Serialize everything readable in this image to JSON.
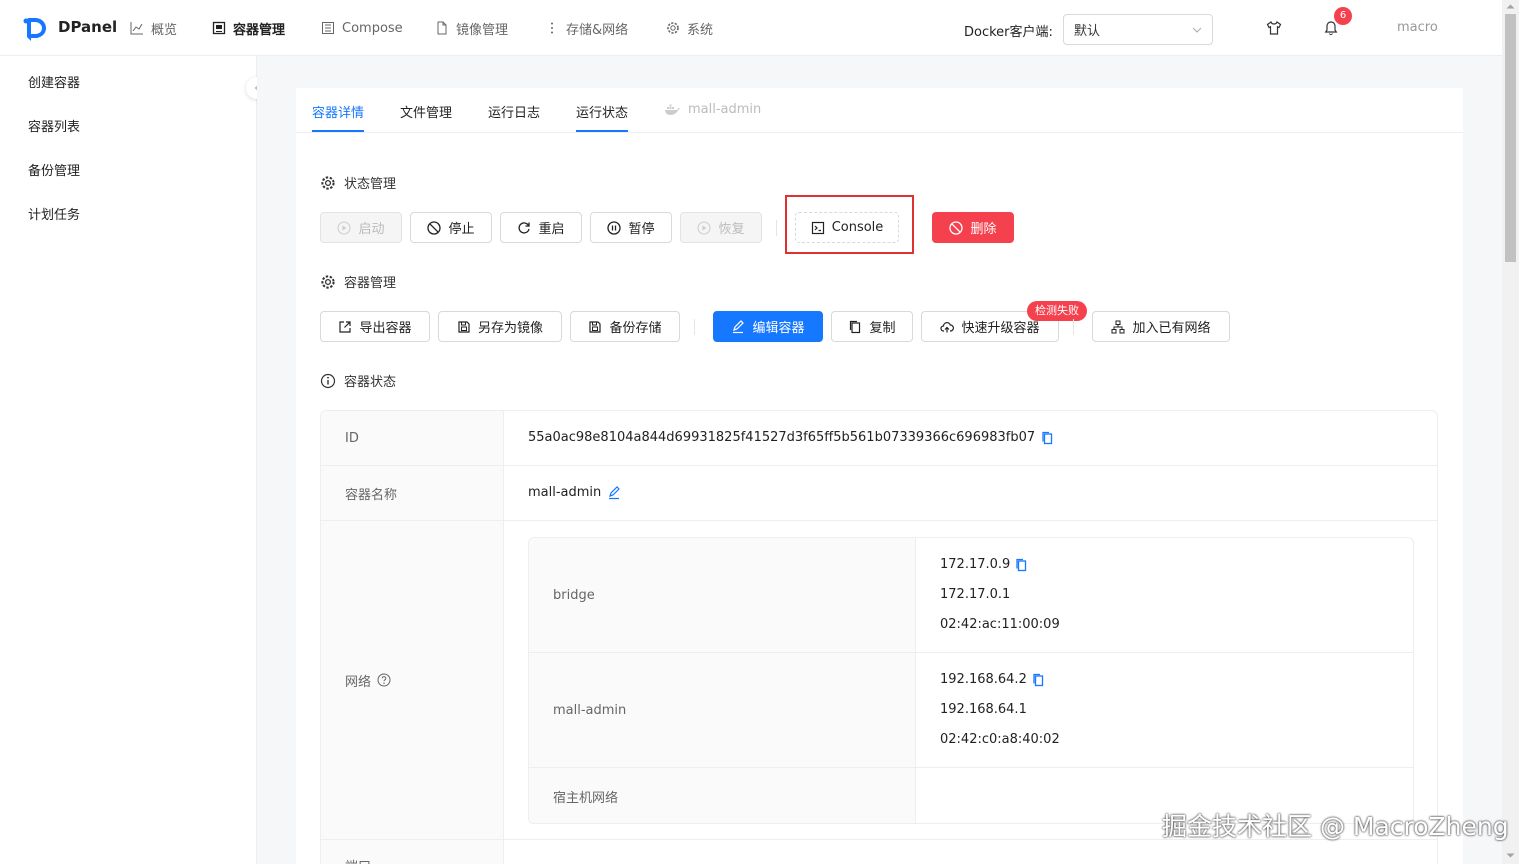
{
  "app": {
    "name": "DPanel"
  },
  "nav": {
    "items": [
      {
        "label": "概览",
        "icon": "chart-icon"
      },
      {
        "label": "容器管理",
        "icon": "container-icon"
      },
      {
        "label": "Compose",
        "icon": "compose-icon"
      },
      {
        "label": "镜像管理",
        "icon": "file-icon"
      },
      {
        "label": "存储&网络",
        "icon": "storage-icon"
      },
      {
        "label": "系统",
        "icon": "gear-icon"
      }
    ],
    "active": "容器管理",
    "docker_label": "Docker客户端:",
    "docker_value": "默认",
    "notification_count": "6",
    "user": "macro"
  },
  "sidebar": {
    "items": [
      {
        "label": "创建容器"
      },
      {
        "label": "容器列表"
      },
      {
        "label": "备份管理"
      },
      {
        "label": "计划任务"
      }
    ]
  },
  "tabs": {
    "items": [
      {
        "label": "容器详情",
        "state": "active"
      },
      {
        "label": "文件管理",
        "state": "normal"
      },
      {
        "label": "运行日志",
        "state": "normal"
      },
      {
        "label": "运行状态",
        "state": "underline"
      },
      {
        "label": "mall-admin",
        "state": "disabled"
      }
    ]
  },
  "state_section": {
    "title": "状态管理",
    "buttons": [
      {
        "label": "启动",
        "icon": "play-circle-icon",
        "disabled": true
      },
      {
        "label": "停止",
        "icon": "stop-icon",
        "disabled": false
      },
      {
        "label": "重启",
        "icon": "restart-icon",
        "disabled": false
      },
      {
        "label": "暂停",
        "icon": "pause-icon",
        "disabled": false
      },
      {
        "label": "恢复",
        "icon": "play-circle-icon",
        "disabled": true
      }
    ],
    "console_label": "Console",
    "delete_label": "删除"
  },
  "container_section": {
    "title": "容器管理",
    "buttons": [
      {
        "label": "导出容器",
        "icon": "export-icon"
      },
      {
        "label": "另存为镜像",
        "icon": "save-icon"
      },
      {
        "label": "备份存储",
        "icon": "save-icon"
      },
      {
        "label": "编辑容器",
        "icon": "edit-icon"
      },
      {
        "label": "复制",
        "icon": "copy-icon"
      },
      {
        "label": "快速升级容器",
        "icon": "cloud-upload-icon"
      },
      {
        "label": "加入已有网络",
        "icon": "network-icon"
      }
    ],
    "upgrade_badge": "检测失败"
  },
  "status_section": {
    "title": "容器状态",
    "id_label": "ID",
    "id_value": "55a0ac98e8104a844d69931825f41527d3f65ff5b561b07339366c696983fb07",
    "name_label": "容器名称",
    "name_value": "mall-admin",
    "network_label": "网络",
    "networks": [
      {
        "name": "bridge",
        "ip": "172.17.0.9",
        "gateway": "172.17.0.1",
        "mac": "02:42:ac:11:00:09"
      },
      {
        "name": "mall-admin",
        "ip": "192.168.64.2",
        "gateway": "192.168.64.1",
        "mac": "02:42:c0:a8:40:02"
      },
      {
        "name": "宿主机网络",
        "ip": "",
        "gateway": "",
        "mac": ""
      }
    ],
    "next_label": "端口"
  },
  "watermark": "掘金技术社区 @ MacroZheng",
  "colors": {
    "primary": "#1677ff",
    "danger": "#f5414e",
    "highlight": "#e03131"
  }
}
